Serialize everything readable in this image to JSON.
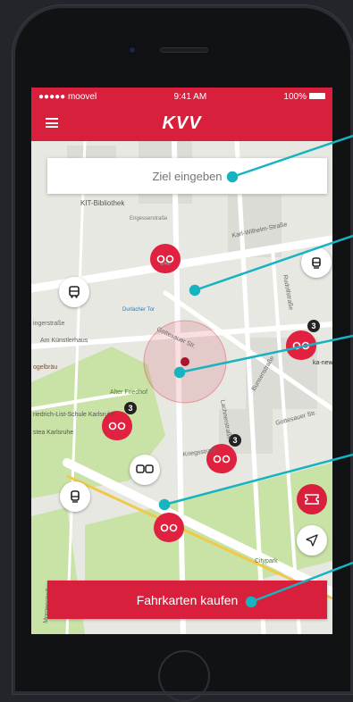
{
  "status": {
    "carrier": "●●●●● moovel",
    "time": "9:41 AM",
    "battery": "100%"
  },
  "app": {
    "title": "KVV"
  },
  "search": {
    "placeholder": "Ziel eingeben"
  },
  "streets": [
    "KIT-Bibliothek",
    "Engesserstraße",
    "Karl-Wilhelm-Straße",
    "Durlacher Tor",
    "Gottesauer Str.",
    "ingerstraße",
    "Am Künstlerhaus",
    "ogelbräu",
    "Alter Friedhof",
    "riedrich-List-Schule Karlsruhe",
    "stea Karlsruhe",
    "Kriegsstraße",
    "Lachnerstraße",
    "Gottesauer Str.",
    "ka-new",
    "Citypark",
    "Rudolfstraße",
    "Bunsenstraße",
    "Morgenstraße"
  ],
  "badges": {
    "station_3a": "3",
    "station_3b": "3",
    "station_3c": "3"
  },
  "buttons": {
    "buy": "Fahrkarten kaufen"
  },
  "colors": {
    "brand": "#d81f3c",
    "callout": "#17b3c1"
  },
  "icons": [
    "menu-icon",
    "bike-icon",
    "bus-icon",
    "tram-icon",
    "ticket-icon",
    "locate-icon",
    "pin-icon"
  ]
}
